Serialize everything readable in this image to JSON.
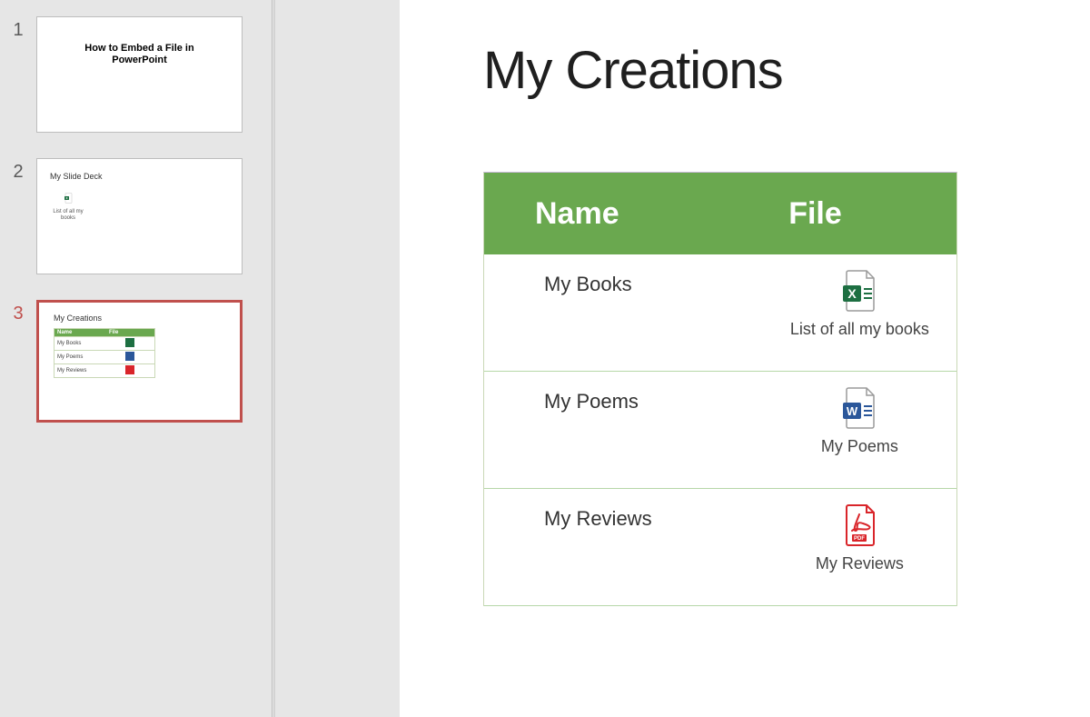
{
  "thumbnails": {
    "s1": {
      "num": "1",
      "title": "How to Embed a File in PowerPoint"
    },
    "s2": {
      "num": "2",
      "title": "My Slide Deck",
      "embed_label": "List of all my books"
    },
    "s3": {
      "num": "3",
      "title": "My Creations",
      "head_name": "Name",
      "head_file": "File",
      "rows": {
        "r1": "My Books",
        "r2": "My Poems",
        "r3": "My Reviews"
      }
    }
  },
  "slide": {
    "title": "My Creations",
    "table": {
      "head_name": "Name",
      "head_file": "File",
      "rows": {
        "r1": {
          "name": "My Books",
          "file_label": "List of all my books",
          "icon": "excel"
        },
        "r2": {
          "name": "My Poems",
          "file_label": "My Poems",
          "icon": "word"
        },
        "r3": {
          "name": "My Reviews",
          "file_label": "My Reviews",
          "icon": "pdf"
        }
      }
    }
  },
  "colors": {
    "table_header": "#6aa84f",
    "selected_thumb_border": "#c0504d"
  }
}
